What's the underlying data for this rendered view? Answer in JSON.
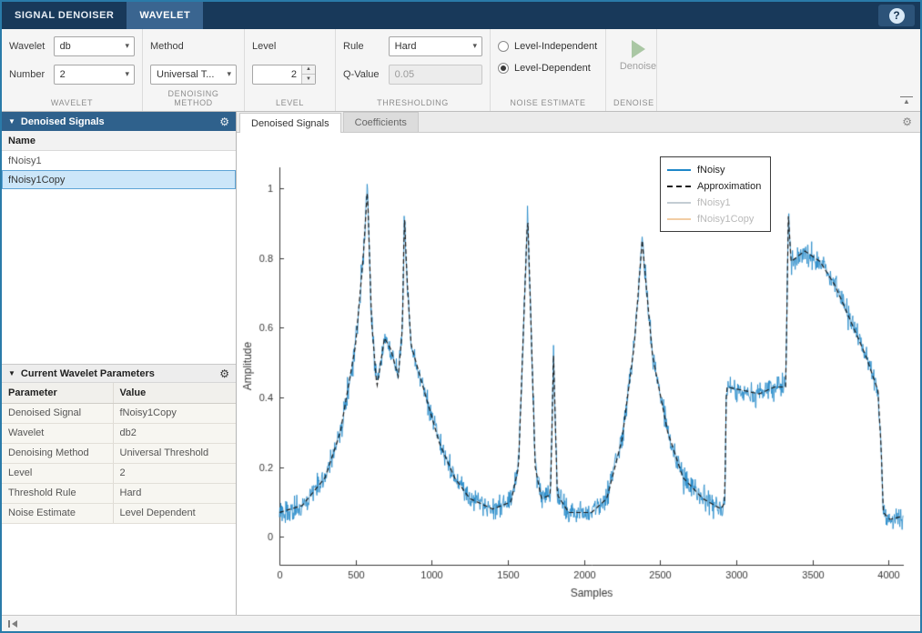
{
  "titlebar": {
    "tabs": [
      {
        "label": "SIGNAL DENOISER",
        "active": false
      },
      {
        "label": "WAVELET",
        "active": true
      }
    ],
    "help_label": "?"
  },
  "toolstrip": {
    "wavelet_section_label": "WAVELET",
    "wavelet_label": "Wavelet",
    "wavelet_value": "db",
    "number_label": "Number",
    "number_value": "2",
    "method_section_label": "DENOISING METHOD",
    "method_label": "Method",
    "method_value": "Universal T...",
    "level_section_label": "LEVEL",
    "level_label": "Level",
    "level_value": "2",
    "thresholding_section_label": "THRESHOLDING",
    "rule_label": "Rule",
    "rule_value": "Hard",
    "qvalue_label": "Q-Value",
    "qvalue_value": "0.05",
    "noise_section_label": "NOISE ESTIMATE",
    "noise_options": [
      {
        "label": "Level-Independent",
        "selected": false
      },
      {
        "label": "Level-Dependent",
        "selected": true
      }
    ],
    "denoise_section_label": "DENOISE",
    "denoise_label": "Denoise"
  },
  "left_panel": {
    "signals_panel": {
      "title": "Denoised Signals",
      "name_header": "Name",
      "rows": [
        {
          "name": "fNoisy1",
          "selected": false
        },
        {
          "name": "fNoisy1Copy",
          "selected": true
        }
      ]
    },
    "params_panel": {
      "title": "Current Wavelet Parameters",
      "columns": [
        "Parameter",
        "Value"
      ],
      "rows": [
        {
          "parameter": "Denoised Signal",
          "value": "fNoisy1Copy"
        },
        {
          "parameter": "Wavelet",
          "value": "db2"
        },
        {
          "parameter": "Denoising Method",
          "value": "Universal Threshold"
        },
        {
          "parameter": "Level",
          "value": "2"
        },
        {
          "parameter": "Threshold Rule",
          "value": "Hard"
        },
        {
          "parameter": "Noise Estimate",
          "value": "Level Dependent"
        }
      ]
    }
  },
  "main": {
    "tabs": [
      {
        "label": "Denoised Signals",
        "active": true
      },
      {
        "label": "Coefficients",
        "active": false
      }
    ]
  },
  "chart_data": {
    "type": "line",
    "title": "",
    "xlabel": "Samples",
    "ylabel": "Amplitude",
    "xlim": [
      0,
      4100
    ],
    "ylim": [
      -0.08,
      1.06
    ],
    "xticks": [
      0,
      500,
      1000,
      1500,
      2000,
      2500,
      3000,
      3500,
      4000
    ],
    "yticks": [
      0,
      0.2,
      0.4,
      0.6,
      0.8,
      1
    ],
    "grid": false,
    "n_samples": 4096,
    "legend": [
      {
        "label": "fNoisy",
        "color": "#1e87c8",
        "dash": false,
        "muted": false
      },
      {
        "label": "Approximation",
        "color": "#1a1a1a",
        "dash": true,
        "muted": false
      },
      {
        "label": "fNoisy1",
        "color": "#c3cdd3",
        "dash": false,
        "muted": true
      },
      {
        "label": "fNoisy1Copy",
        "color": "#f2cda4",
        "dash": false,
        "muted": true
      }
    ],
    "signal_keypoints": [
      [
        0,
        0.07
      ],
      [
        150,
        0.09
      ],
      [
        300,
        0.17
      ],
      [
        400,
        0.3
      ],
      [
        500,
        0.55
      ],
      [
        550,
        0.8
      ],
      [
        578,
        1.0
      ],
      [
        605,
        0.62
      ],
      [
        640,
        0.43
      ],
      [
        690,
        0.57
      ],
      [
        730,
        0.54
      ],
      [
        780,
        0.46
      ],
      [
        808,
        0.6
      ],
      [
        820,
        0.93
      ],
      [
        838,
        0.74
      ],
      [
        865,
        0.55
      ],
      [
        950,
        0.42
      ],
      [
        1050,
        0.27
      ],
      [
        1150,
        0.17
      ],
      [
        1250,
        0.11
      ],
      [
        1400,
        0.08
      ],
      [
        1520,
        0.1
      ],
      [
        1570,
        0.2
      ],
      [
        1630,
        0.93
      ],
      [
        1680,
        0.2
      ],
      [
        1720,
        0.11
      ],
      [
        1780,
        0.12
      ],
      [
        1800,
        0.52
      ],
      [
        1825,
        0.12
      ],
      [
        1900,
        0.07
      ],
      [
        2050,
        0.07
      ],
      [
        2150,
        0.11
      ],
      [
        2250,
        0.28
      ],
      [
        2330,
        0.55
      ],
      [
        2382,
        0.85
      ],
      [
        2450,
        0.52
      ],
      [
        2550,
        0.3
      ],
      [
        2650,
        0.17
      ],
      [
        2780,
        0.11
      ],
      [
        2900,
        0.08
      ],
      [
        2925,
        0.1
      ],
      [
        2935,
        0.43
      ],
      [
        3050,
        0.42
      ],
      [
        3150,
        0.41
      ],
      [
        3250,
        0.43
      ],
      [
        3325,
        0.43
      ],
      [
        3342,
        0.92
      ],
      [
        3360,
        0.79
      ],
      [
        3450,
        0.82
      ],
      [
        3550,
        0.79
      ],
      [
        3650,
        0.72
      ],
      [
        3750,
        0.62
      ],
      [
        3850,
        0.52
      ],
      [
        3930,
        0.42
      ],
      [
        3952,
        0.25
      ],
      [
        3965,
        0.07
      ],
      [
        4010,
        0.05
      ],
      [
        4096,
        0.06
      ]
    ],
    "series": [
      {
        "name": "fNoisy",
        "color": "#1e87c8",
        "style": "solid",
        "noise_amplitude": 0.05,
        "source": "signal_keypoints"
      },
      {
        "name": "Approximation",
        "color": "#1a1a1a",
        "style": "dashed",
        "noise_amplitude": 0,
        "source": "signal_keypoints"
      }
    ]
  }
}
